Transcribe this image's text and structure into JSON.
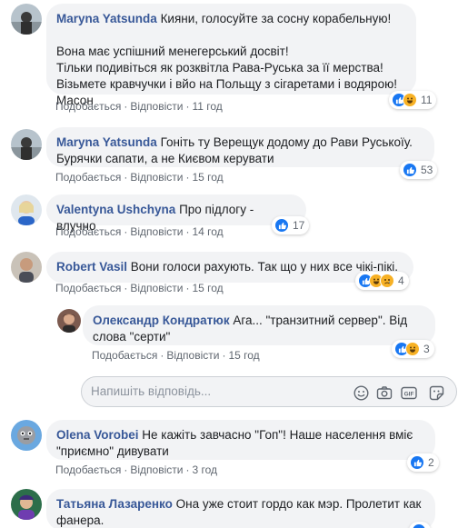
{
  "comments": [
    {
      "author": "Maryna Yatsunda",
      "text": "Кияни, голосуйте за сосну корабельную!\n\nВона має успішний менегерський досвіт!\nТільки подивіться як розквітла Рава-Руська за її мерства!\nВізьмете кравчучки і вйо на Польщу з сігаретами і водярою!\nМасон",
      "like_label": "Подобається",
      "reply_label": "Відповісти",
      "time": "11 год",
      "reaction_count": "11",
      "reactions": [
        "like",
        "haha"
      ]
    },
    {
      "author": "Maryna Yatsunda",
      "text": "Гоніть ту Верещук додому до Рави Руськоїу. Бурячки сапати, а не Києвом керувати",
      "like_label": "Подобається",
      "reply_label": "Відповісти",
      "time": "15 год",
      "reaction_count": "53",
      "reactions": [
        "like"
      ]
    },
    {
      "author": "Valentyna Ushchyna",
      "text": "Про підлогу - влучно",
      "like_label": "Подобається",
      "reply_label": "Відповісти",
      "time": "14 год",
      "reaction_count": "17",
      "reactions": [
        "like"
      ]
    },
    {
      "author": "Robert Vasil",
      "text": "Вони голоси рахують. Так що у них все чікі-пікі.",
      "like_label": "Подобається",
      "reply_label": "Відповісти",
      "time": "15 год",
      "reaction_count": "4",
      "reactions": [
        "like",
        "haha",
        "sad"
      ]
    },
    {
      "author": "Олександр Кондратюк",
      "text": "Ага... \"транзитний сервер\". Від слова \"серти\"",
      "like_label": "Подобається",
      "reply_label": "Відповісти",
      "time": "15 год",
      "reaction_count": "3",
      "reactions": [
        "like",
        "haha"
      ]
    },
    {
      "author": "Olena Vorobei",
      "text": "Не кажіть завчасно \"Гоп\"! Наше населення вміє \"приємно\" дивувати",
      "like_label": "Подобається",
      "reply_label": "Відповісти",
      "time": "3 год",
      "reaction_count": "2",
      "reactions": [
        "like"
      ]
    },
    {
      "author": "Татьяна Лазаренко",
      "text": "Она уже стоит гордо как мэр. Пролетит как фанера.",
      "reactions": [
        "like"
      ]
    }
  ],
  "reply_box": {
    "placeholder": "Напишіть відповідь...",
    "icons": [
      "emoji-icon",
      "camera-icon",
      "gif-icon",
      "sticker-icon"
    ]
  },
  "colors": {
    "author": "#385898",
    "bubble": "#f2f3f5",
    "like": "#1877f2",
    "haha": "#f7b125"
  }
}
